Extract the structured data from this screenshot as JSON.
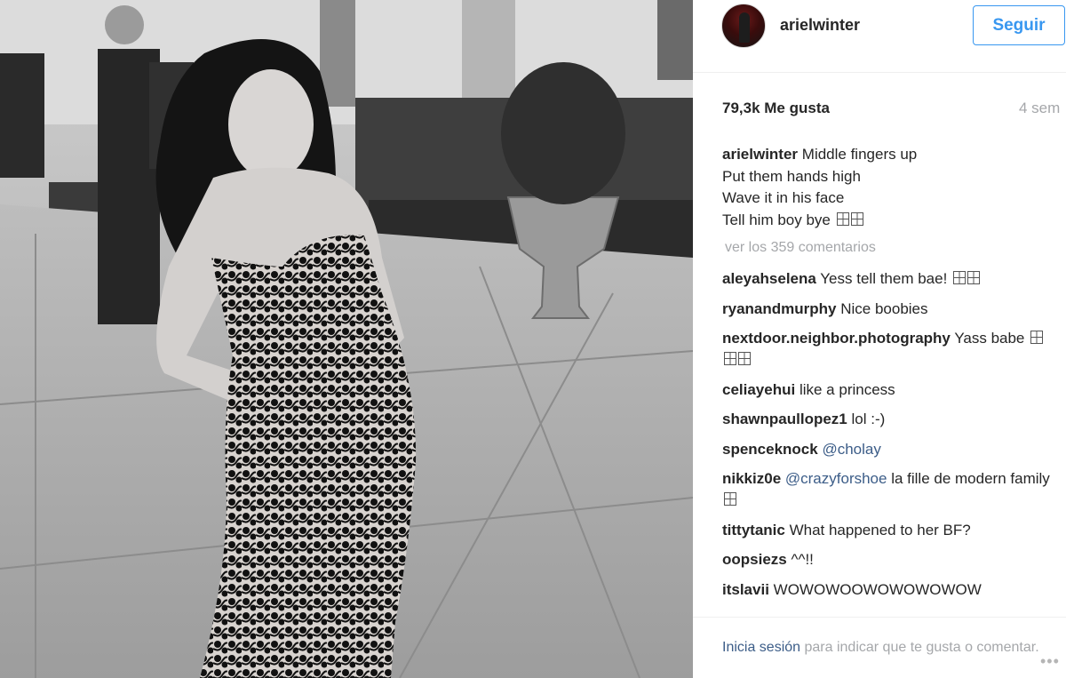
{
  "post": {
    "image_alt": "black and white photo of a woman in a strapless lace gown"
  },
  "header": {
    "username": "arielwinter",
    "follow_label": "Seguir"
  },
  "stats": {
    "likes": "79,3k Me gusta",
    "time": "4 sem"
  },
  "caption": {
    "username": "arielwinter",
    "lines": [
      "Middle fingers up",
      "Put them hands high",
      "Wave it in his face",
      "Tell him boy bye"
    ]
  },
  "view_all_comments": "ver los 359 comentarios",
  "comments": [
    {
      "user": "aleyahselena",
      "text": "Yess tell them bae!",
      "emoji_count": 2
    },
    {
      "user": "ryanandmurphy",
      "text": "Nice boobies"
    },
    {
      "user": "nextdoor.neighbor.photography",
      "text": "Yass babe",
      "emoji_count": 3
    },
    {
      "user": "celiayehui",
      "text": "like a princess"
    },
    {
      "user": "shawnpaullopez1",
      "text": "lol :-)"
    },
    {
      "user": "spenceknock",
      "mention": "@cholay"
    },
    {
      "user": "nikkiz0e",
      "mention": "@crazyforshoe",
      "text": "la fille de modern family",
      "emoji_count": 1
    },
    {
      "user": "tittytanic",
      "text": "What happened to her BF?"
    },
    {
      "user": "oopsiezs",
      "text": "^^!!"
    },
    {
      "user": "itslavii",
      "text": "WOWOWOOWOWOWOWOW"
    }
  ],
  "footer": {
    "login_link": "Inicia sesión",
    "login_text": "para indicar que te gusta o comentar.",
    "more_icon": "more-options-icon"
  },
  "colors": {
    "follow_blue": "#3897f0",
    "link_blue": "#3c5d88",
    "muted_gray": "#a5a7aa"
  }
}
